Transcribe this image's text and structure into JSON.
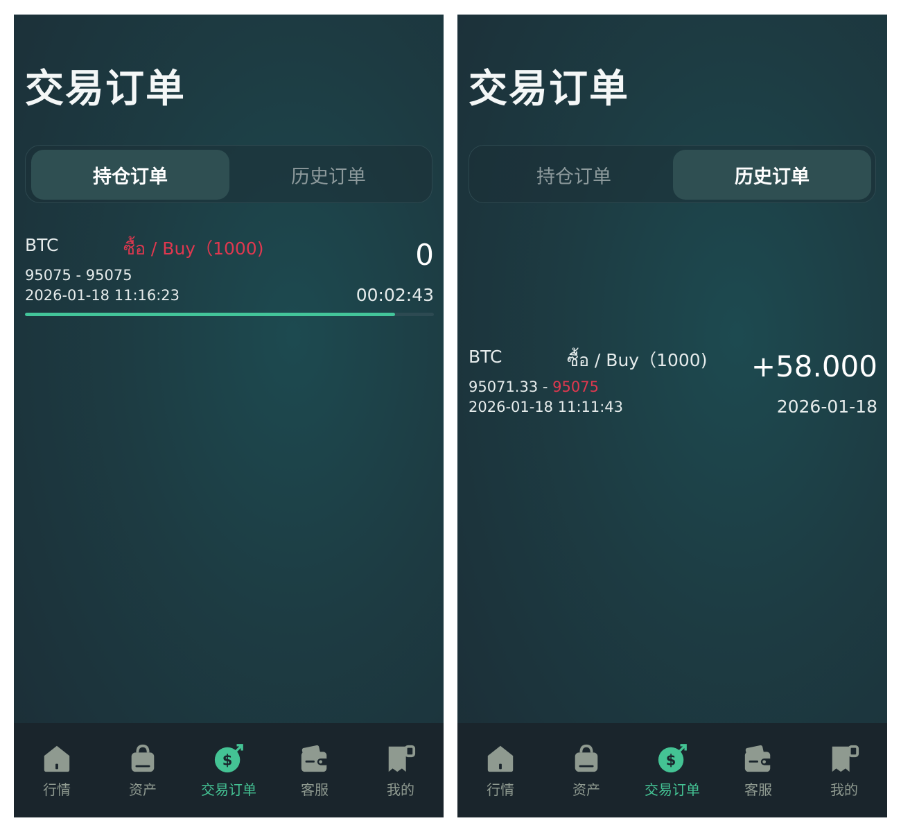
{
  "colors": {
    "accent": "#44c394",
    "sell_red": "#e0384f",
    "nav_inactive": "#8f9a90",
    "nav_bg": "#1a252c"
  },
  "screens": [
    {
      "title": "交易订单",
      "tabs": [
        {
          "label": "持仓订单",
          "active": true
        },
        {
          "label": "历史订单",
          "active": false
        }
      ],
      "order": {
        "symbol": "BTC",
        "side": "ซื้อ / Buy（1000)",
        "price_open": "95075",
        "price_sep": " - ",
        "price_close": "95075",
        "time": "2026-01-18 11:16:23",
        "pnl": "0",
        "countdown": "00:02:43",
        "progress": 0.905
      }
    },
    {
      "title": "交易订单",
      "tabs": [
        {
          "label": "持仓订单",
          "active": false
        },
        {
          "label": "历史订单",
          "active": true
        }
      ],
      "order": {
        "symbol": "BTC",
        "side": "ซื้อ / Buy（1000)",
        "price_open": "95071.33",
        "price_sep": " - ",
        "price_close": "95075",
        "time": "2026-01-18 11:11:43",
        "pnl": "+58.000",
        "date": "2026-01-18"
      }
    }
  ],
  "nav": {
    "items": [
      {
        "label": "行情",
        "icon": "home-icon"
      },
      {
        "label": "资产",
        "icon": "bag-icon"
      },
      {
        "label": "交易订单",
        "icon": "dollar-arrow-icon",
        "active": true
      },
      {
        "label": "客服",
        "icon": "wallet-icon"
      },
      {
        "label": "我的",
        "icon": "receipt-icon"
      }
    ]
  }
}
